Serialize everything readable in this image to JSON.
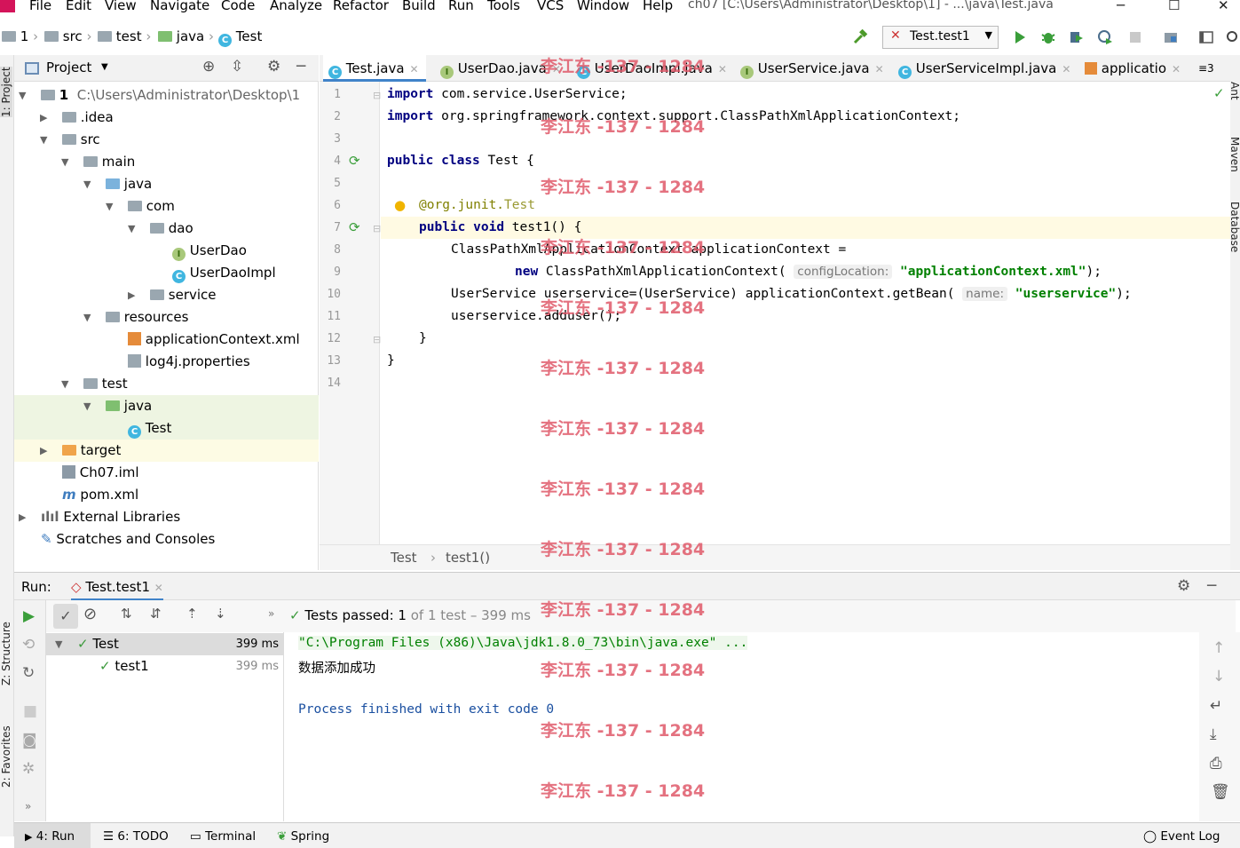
{
  "menu": [
    "File",
    "Edit",
    "View",
    "Navigate",
    "Code",
    "Analyze",
    "Refactor",
    "Build",
    "Run",
    "Tools",
    "VCS",
    "Window",
    "Help"
  ],
  "window_title": "ch07 [C:\\Users\\Administrator\\Desktop\\1] - ...\\java\\Test.java",
  "breadcrumb": [
    "1",
    "src",
    "test",
    "java",
    "Test"
  ],
  "run_config": "Test.test1",
  "project": {
    "title": "Project",
    "tree": [
      {
        "label": "1",
        "path": "C:\\Users\\Administrator\\Desktop\\1"
      },
      {
        "label": ".idea"
      },
      {
        "label": "src"
      },
      {
        "label": "main"
      },
      {
        "label": "java"
      },
      {
        "label": "com"
      },
      {
        "label": "dao"
      },
      {
        "label": "UserDao"
      },
      {
        "label": "UserDaoImpl"
      },
      {
        "label": "service"
      },
      {
        "label": "resources"
      },
      {
        "label": "applicationContext.xml"
      },
      {
        "label": "log4j.properties"
      },
      {
        "label": "test"
      },
      {
        "label": "java"
      },
      {
        "label": "Test"
      },
      {
        "label": "target"
      },
      {
        "label": "Ch07.iml"
      },
      {
        "label": "pom.xml"
      },
      {
        "label": "External Libraries"
      },
      {
        "label": "Scratches and Consoles"
      }
    ]
  },
  "tabs": [
    {
      "label": "Test.java",
      "icon": "class-icon"
    },
    {
      "label": "UserDao.java",
      "icon": "interface-icon"
    },
    {
      "label": "UserDaoImpl.java",
      "icon": "class-icon"
    },
    {
      "label": "UserService.java",
      "icon": "interface-icon"
    },
    {
      "label": "UserServiceImpl.java",
      "icon": "class-icon"
    },
    {
      "label": "applicatio",
      "icon": "xml-icon"
    },
    {
      "label": "≡3"
    }
  ],
  "code": {
    "line_numbers": [
      "1",
      "2",
      "3",
      "4",
      "5",
      "6",
      "7",
      "8",
      "9",
      "10",
      "11",
      "12",
      "13",
      "14"
    ],
    "l1": {
      "kw": "import",
      "rest": " com.service.UserService;"
    },
    "l2": {
      "kw": "import",
      "rest": " org.springframework.context.support.ClassPathXmlApplicationContext;"
    },
    "l4": {
      "kw1": "public",
      "kw2": "class",
      "rest": " Test {"
    },
    "l6": {
      "ann": "@org.junit.",
      "ann2": "Test"
    },
    "l7": {
      "kw1": "public",
      "kw2": "void",
      "rest": " test1() {"
    },
    "l8": "ClassPathXmlApplicationContext applicationContext =",
    "l9": {
      "kw": "new",
      "pre": " ClassPathXmlApplicationContext(",
      "hint": "configLocation:",
      "str": "\"applicationContext.xml\"",
      "post": ");"
    },
    "l10": {
      "pre": "UserService userservice=(UserService) applicationContext.getBean(",
      "hint": "name:",
      "str": "\"userservice\"",
      "post": ");"
    },
    "l11": "userservice.adduser();",
    "l12": "}",
    "l13": "}"
  },
  "code_breadcrumb": {
    "cls": "Test",
    "method": "test1()"
  },
  "run": {
    "label": "Run:",
    "tab": "Test.test1",
    "tests_passed": "Tests passed:",
    "passed_count": "1",
    "of_text": "of 1 test – 399 ms",
    "tree": [
      {
        "label": "Test",
        "time": "399 ms"
      },
      {
        "label": "test1",
        "time": "399 ms"
      }
    ],
    "console": [
      "\"C:\\Program Files (x86)\\Java\\jdk1.8.0_73\\bin\\java.exe\" ...",
      "数据添加成功",
      "",
      "Process finished with exit code 0"
    ]
  },
  "left_strip": [
    "1: Project",
    "Z: Structure",
    "2: Favorites"
  ],
  "right_strip": [
    "Ant",
    "Maven",
    "Database"
  ],
  "status": {
    "run": "4: Run",
    "todo": "6: TODO",
    "terminal": "Terminal",
    "spring": "Spring",
    "event_log": "Event Log"
  },
  "watermark": "李江东 -137 - 1284"
}
